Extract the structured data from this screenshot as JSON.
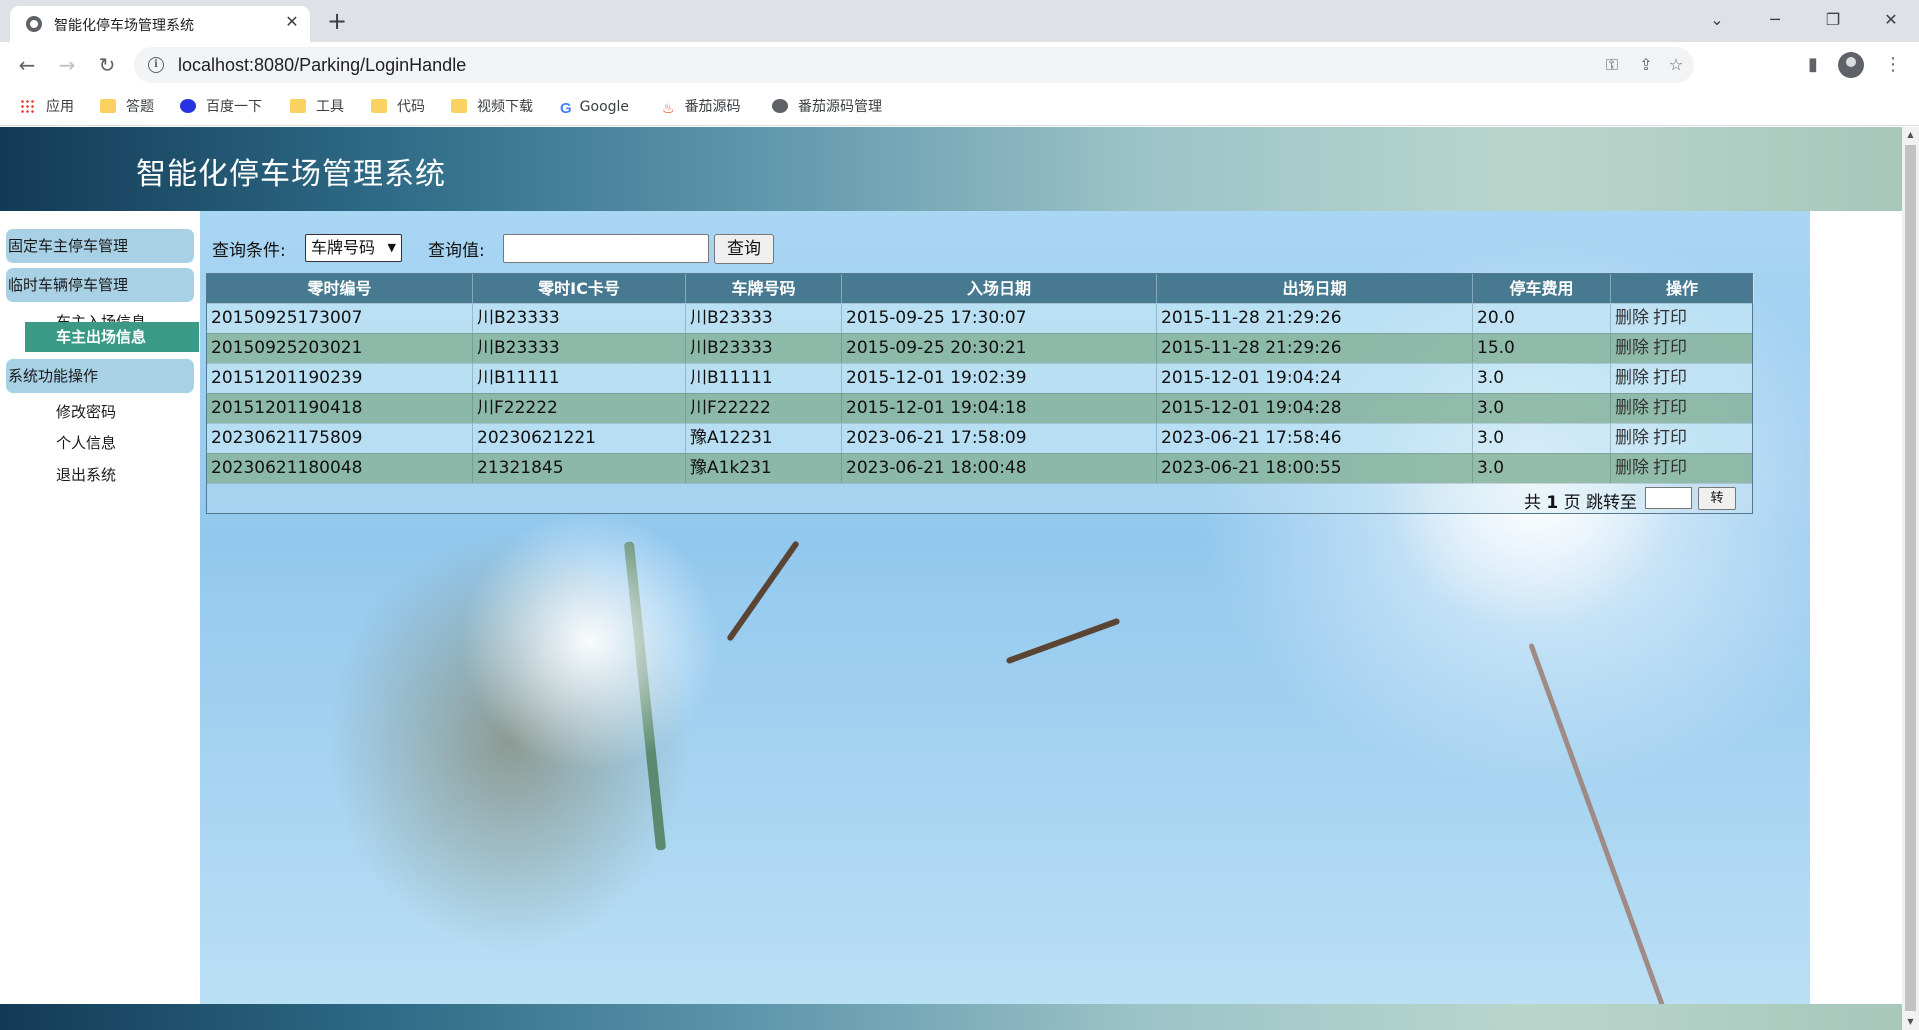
{
  "browser": {
    "tab_title": "智能化停车场管理系统",
    "url": "localhost:8080/Parking/LoginHandle",
    "bookmarks": [
      {
        "label": "应用",
        "icon": "apps-grid-icon"
      },
      {
        "label": "答题",
        "icon": "folder-icon"
      },
      {
        "label": "百度一下",
        "icon": "baidu-paw-icon"
      },
      {
        "label": "工具",
        "icon": "folder-icon"
      },
      {
        "label": "代码",
        "icon": "folder-icon"
      },
      {
        "label": "视频下载",
        "icon": "folder-icon"
      },
      {
        "label": "Google",
        "icon": "google-icon"
      },
      {
        "label": "番茄源码",
        "icon": "flame-icon"
      },
      {
        "label": "番茄源码管理",
        "icon": "globe-icon"
      }
    ]
  },
  "header": {
    "title": "智能化停车场管理系统"
  },
  "sidebar": {
    "groups": [
      {
        "title": "固定车主停车管理",
        "items": []
      },
      {
        "title": "临时车辆停车管理",
        "items": [
          {
            "label": "车主入场信息",
            "active": false
          },
          {
            "label": "车主出场信息",
            "active": true
          }
        ]
      },
      {
        "title": "系统功能操作",
        "items": [
          {
            "label": "修改密码",
            "active": false
          },
          {
            "label": "个人信息",
            "active": false
          },
          {
            "label": "退出系统",
            "active": false
          }
        ]
      }
    ]
  },
  "query": {
    "condition_label": "查询条件:",
    "condition_value": "车牌号码",
    "value_label": "查询值:",
    "value_input": "",
    "search_button": "查询"
  },
  "table": {
    "columns": [
      "零时编号",
      "零时IC卡号",
      "车牌号码",
      "入场日期",
      "出场日期",
      "停车费用",
      "操作"
    ],
    "rows": [
      [
        "20150925173007",
        "川B23333",
        "川B23333",
        "2015-09-25 17:30:07",
        "2015-11-28 21:29:26",
        "20.0"
      ],
      [
        "20150925203021",
        "川B23333",
        "川B23333",
        "2015-09-25 20:30:21",
        "2015-11-28 21:29:26",
        "15.0"
      ],
      [
        "20151201190239",
        "川B11111",
        "川B11111",
        "2015-12-01 19:02:39",
        "2015-12-01 19:04:24",
        "3.0"
      ],
      [
        "20151201190418",
        "川F22222",
        "川F22222",
        "2015-12-01 19:04:18",
        "2015-12-01 19:04:28",
        "3.0"
      ],
      [
        "20230621175809",
        "20230621221",
        "豫A12231",
        "2023-06-21 17:58:09",
        "2023-06-21 17:58:46",
        "3.0"
      ],
      [
        "20230621180048",
        "21321845",
        "豫A1k231",
        "2023-06-21 18:00:48",
        "2023-06-21 18:00:55",
        "3.0"
      ]
    ],
    "actions": {
      "delete": "删除",
      "print": "打印"
    }
  },
  "pager": {
    "prefix": "共",
    "total_pages": "1",
    "suffix": "页 跳转至",
    "jump_input": "",
    "go_button": "转"
  }
}
